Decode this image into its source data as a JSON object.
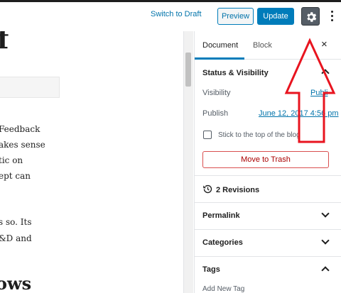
{
  "toolbar": {
    "switch_to_draft": "Switch to Draft",
    "preview": "Preview",
    "update": "Update",
    "settings_icon": "gear-icon",
    "more_icon": "vertical-ellipsis-icon"
  },
  "editor": {
    "heading_top": "f",
    "paragraph_1": [
      "Feedback",
      "akes sense",
      "tic on",
      "ept can"
    ],
    "paragraph_2": [
      "s so. Its",
      "&D and"
    ],
    "heading_bottom": "ows"
  },
  "sidebar": {
    "tabs": [
      {
        "label": "Document",
        "active": true
      },
      {
        "label": "Block",
        "active": false
      }
    ],
    "close_icon": "×",
    "status_visibility": {
      "title": "Status & Visibility",
      "visibility_label": "Visibility",
      "visibility_value": "Publi",
      "publish_label": "Publish",
      "publish_value": "June 12, 2017 4:56 pm",
      "sticky_label": "Stick to the top of the blog",
      "trash_label": "Move to Trash"
    },
    "revisions": {
      "label": "2 Revisions",
      "icon": "history-icon"
    },
    "permalink": {
      "title": "Permalink"
    },
    "categories": {
      "title": "Categories"
    },
    "tags": {
      "title": "Tags",
      "add_new": "Add New Tag"
    }
  },
  "colors": {
    "accent": "#007cba",
    "link": "#0073aa",
    "annotation_red": "#e8141f",
    "danger": "#a00"
  }
}
